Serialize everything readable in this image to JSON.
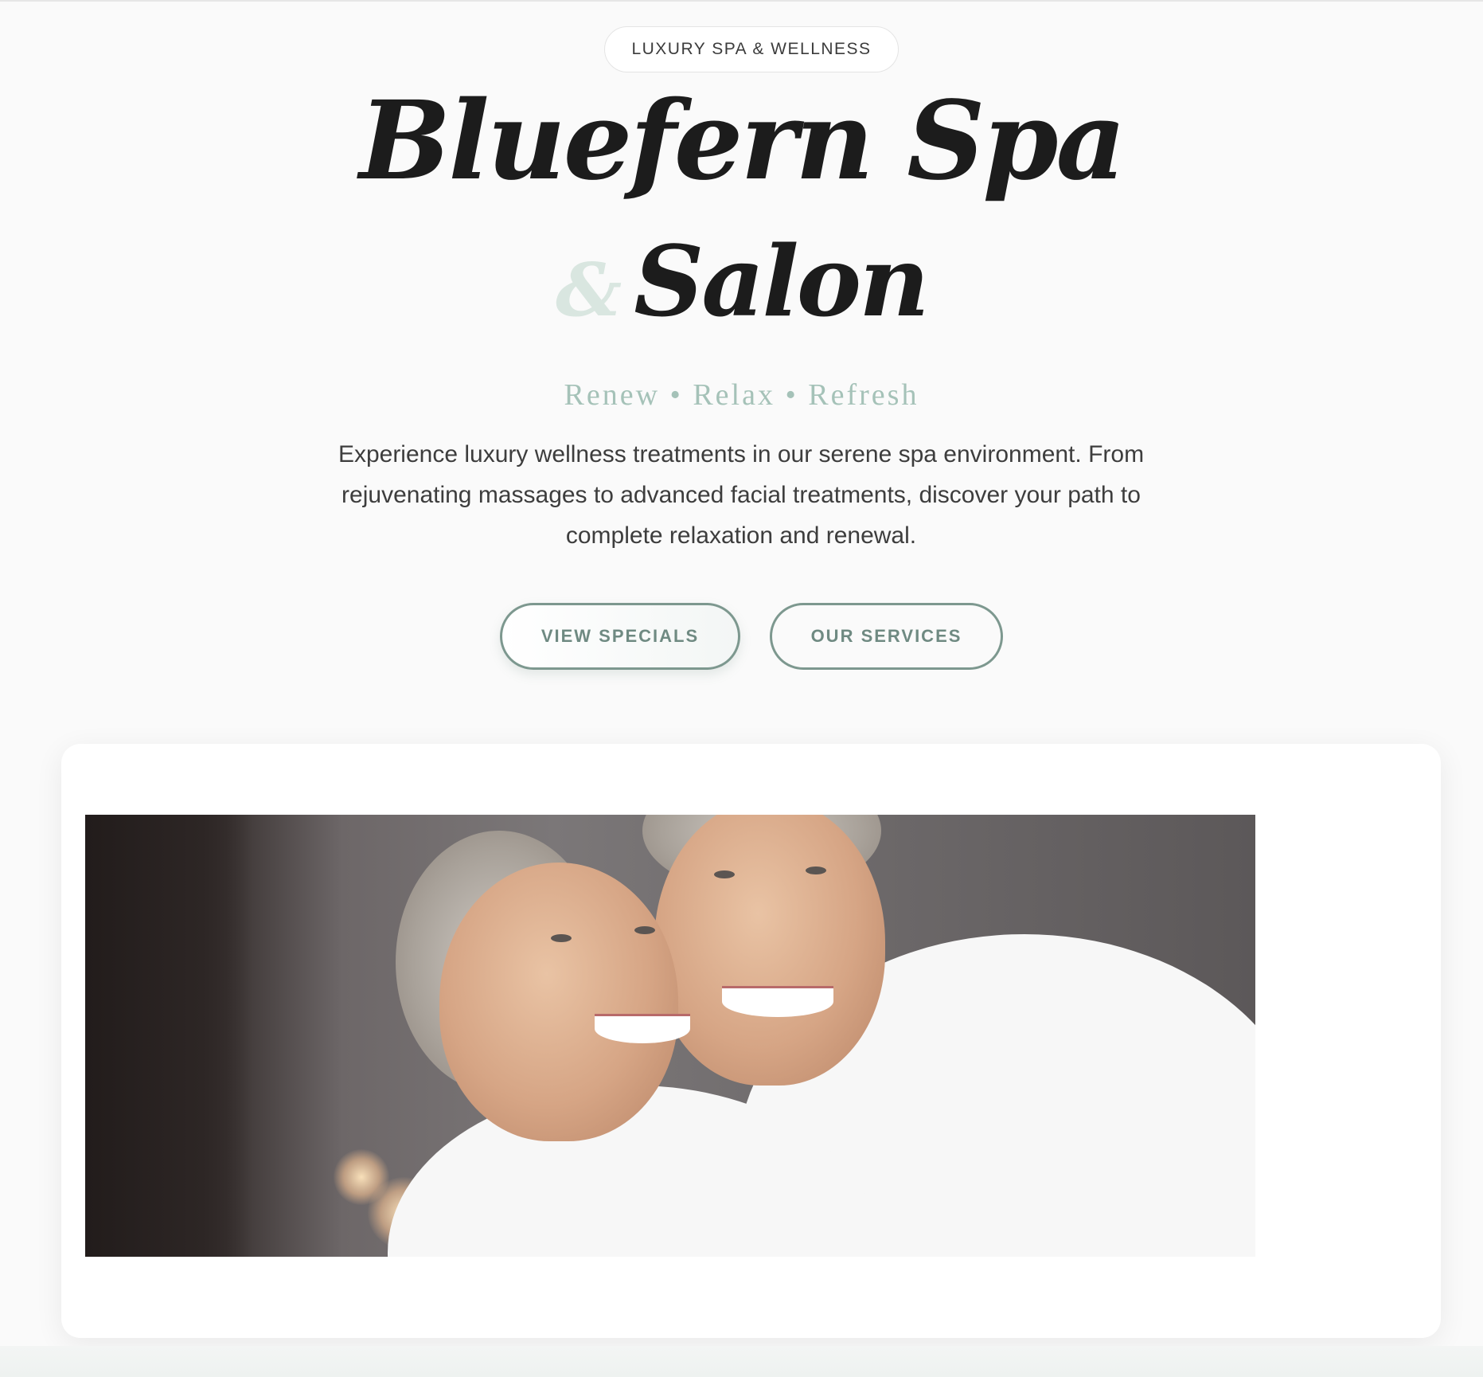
{
  "hero": {
    "badge": "LUXURY SPA & WELLNESS",
    "title_line1": "Bluefern Spa",
    "title_amp": "&",
    "title_line2": "Salon",
    "tagline": "Renew • Relax • Refresh",
    "description": "Experience luxury wellness treatments in our serene spa environment. From rejuvenating massages to advanced facial treatments, discover your path to complete relaxation and renewal.",
    "buttons": {
      "view_specials": "VIEW SPECIALS",
      "our_services": "OUR SERVICES"
    }
  },
  "colors": {
    "accent_green": "#7d988f",
    "tagline_green": "#a5c2b8",
    "amp_green": "#d9e6e0",
    "background": "#fafafa"
  }
}
